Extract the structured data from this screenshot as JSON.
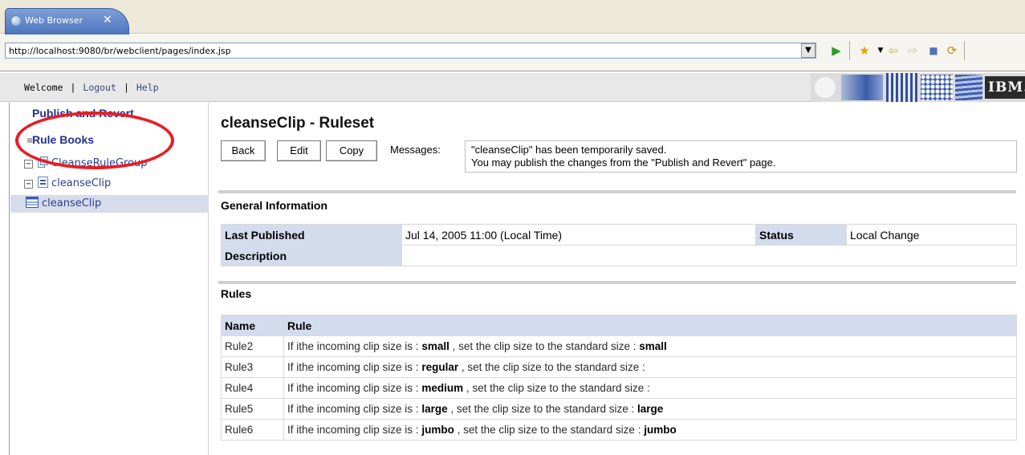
{
  "tab": {
    "title": "Web Browser",
    "close": "✕"
  },
  "address_bar": {
    "url": "http://localhost:9080/br/webclient/pages/index.jsp"
  },
  "header": {
    "welcome": "Welcome",
    "logout": "Logout",
    "help": "Help",
    "sep": "|",
    "logo": "IBM."
  },
  "sidebar": {
    "publish_and_revert": "Publish and Revert",
    "rule_books": "Rule Books",
    "tree": [
      {
        "label": "CleanseRuleGroup"
      },
      {
        "label": "cleanseClip"
      },
      {
        "label": "cleanseClip",
        "selected": true
      }
    ]
  },
  "main": {
    "title": "cleanseClip - Ruleset",
    "buttons": {
      "back": "Back",
      "edit": "Edit",
      "copy": "Copy"
    },
    "messages_label": "Messages:",
    "messages": [
      "\"cleanseClip\" has been temporarily saved.",
      "You may publish the changes from the \"Publish and Revert\" page."
    ],
    "general_info": {
      "heading": "General Information",
      "last_published_label": "Last Published",
      "last_published_value": "Jul 14, 2005 11:00 (Local Time)",
      "status_label": "Status",
      "status_value": "Local Change",
      "description_label": "Description",
      "description_value": ""
    },
    "rules": {
      "heading": "Rules",
      "columns": [
        "Name",
        "Rule"
      ],
      "rows": [
        {
          "name": "Rule2",
          "prefix": "If ithe incoming clip size is : ",
          "in": "small",
          "mid": " , set the clip size to the standard size : ",
          "out": "small"
        },
        {
          "name": "Rule3",
          "prefix": "If ithe incoming clip size is : ",
          "in": "regular",
          "mid": " , set the clip size to the standard size : ",
          "out": ""
        },
        {
          "name": "Rule4",
          "prefix": "If ithe incoming clip size is : ",
          "in": "medium",
          "mid": " , set the clip size to the standard size : ",
          "out": ""
        },
        {
          "name": "Rule5",
          "prefix": "If ithe incoming clip size is : ",
          "in": "large",
          "mid": " , set the clip size to the standard size : ",
          "out": "large"
        },
        {
          "name": "Rule6",
          "prefix": "If ithe incoming clip size is : ",
          "in": "jumbo",
          "mid": " , set the clip size to the standard size : ",
          "out": "jumbo"
        }
      ]
    }
  },
  "colors": {
    "nav_link": "#23308a",
    "table_header": "#d3dced",
    "annotation_oval": "#e81d26",
    "tab_blue": "#4d74bf"
  }
}
